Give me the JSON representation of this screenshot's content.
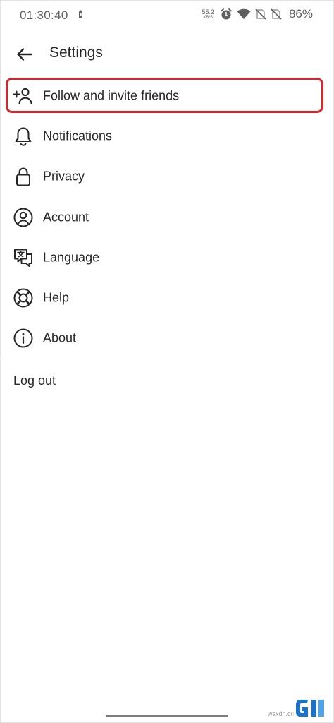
{
  "status_bar": {
    "time": "01:30:40",
    "speed_value": "55.2",
    "speed_unit": "KB/S",
    "battery_percent": "86%"
  },
  "header": {
    "title": "Settings"
  },
  "menu": {
    "items": [
      {
        "label": "Follow and invite friends",
        "icon": "add-person-icon"
      },
      {
        "label": "Notifications",
        "icon": "bell-icon"
      },
      {
        "label": "Privacy",
        "icon": "lock-icon"
      },
      {
        "label": "Account",
        "icon": "account-circle-icon"
      },
      {
        "label": "Language",
        "icon": "translate-icon"
      },
      {
        "label": "Help",
        "icon": "lifebuoy-icon"
      },
      {
        "label": "About",
        "icon": "info-icon"
      }
    ]
  },
  "logout_label": "Log out",
  "watermark_text": "wsxdn.com",
  "colors": {
    "highlight": "#d8242d",
    "text": "#262626"
  }
}
